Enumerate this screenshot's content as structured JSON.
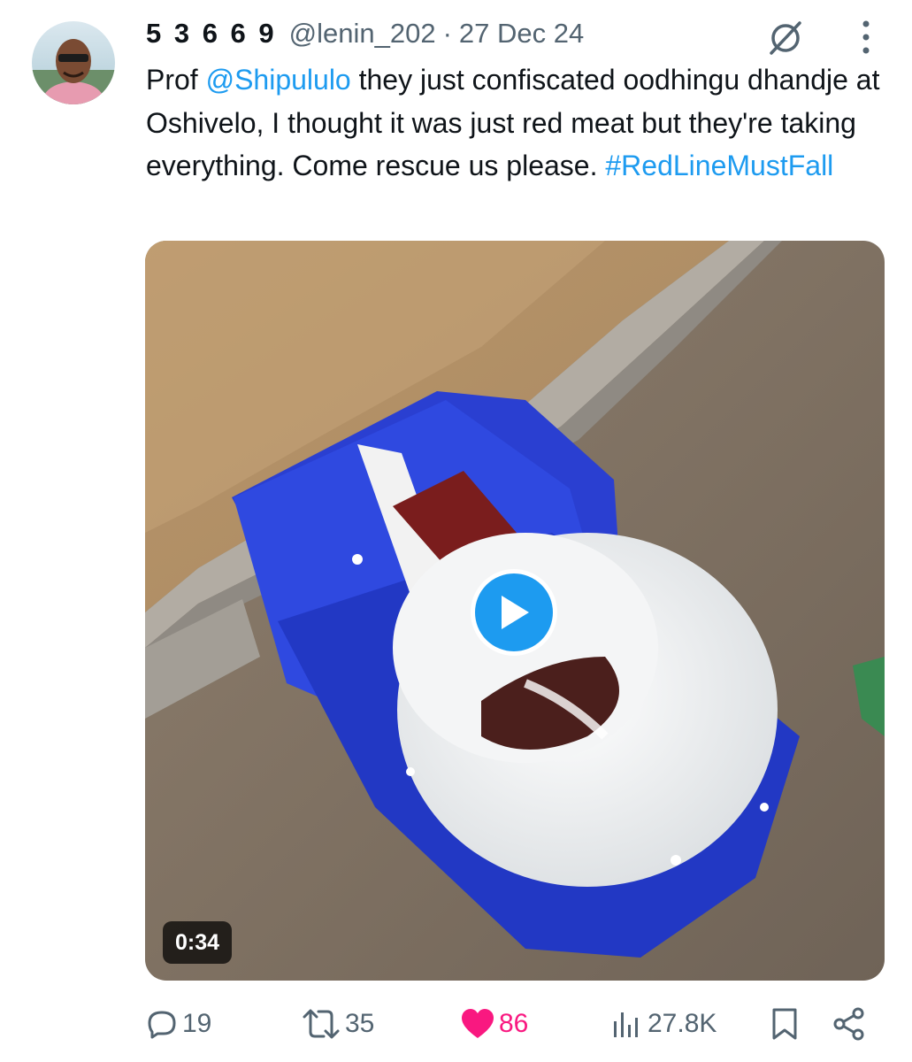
{
  "tweet": {
    "author_name": "5 3 6 6 9",
    "handle": "@lenin_202",
    "separator": "·",
    "date": "27 Dec 24",
    "text_1": "Prof ",
    "mention": "@Shipululo",
    "text_2": " they just confiscated oodhingu dhandje at Oshivelo, I thought it was just red meat but they're taking everything. Come rescue us please. ",
    "hashtag": "#RedLineMustFall"
  },
  "media": {
    "duration": "0:34",
    "play_icon": "play-icon"
  },
  "actions": {
    "replies": "19",
    "reposts": "35",
    "likes": "86",
    "views": "27.8K"
  },
  "colors": {
    "accent": "#1d9bf0",
    "like": "#f91880",
    "muted": "#536471"
  }
}
